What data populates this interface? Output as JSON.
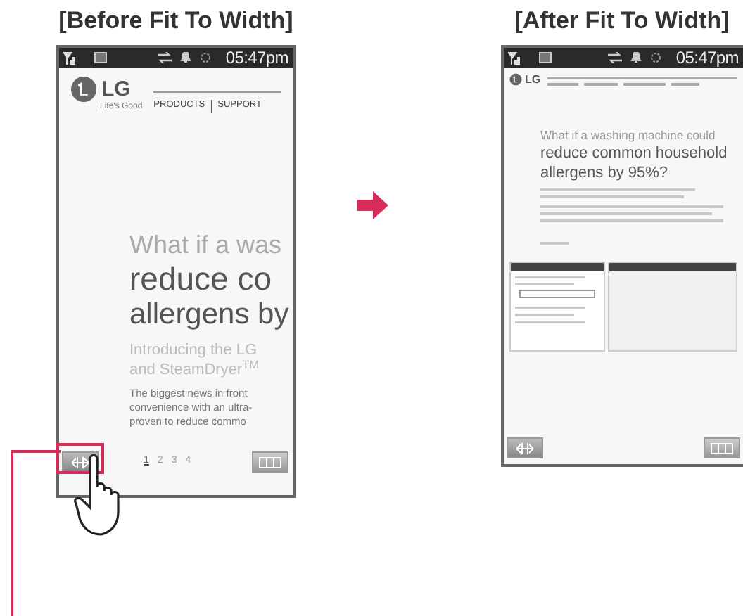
{
  "panels": [
    {
      "kind": "before",
      "caption": "[Before Fit To Width]",
      "status_bar": {
        "time": "05:47pm"
      },
      "logo": {
        "brand": "LG",
        "tagline": "Life's Good"
      },
      "nav": [
        "PRODUCTS",
        "SUPPORT"
      ],
      "headline": [
        "What if a was",
        "reduce co",
        "allergens by"
      ],
      "intro": [
        "Introducing the LG",
        "and SteamDryer$^{TM}$"
      ],
      "body": [
        "The biggest news in front",
        "convenience with an ultra-",
        "proven to reduce commo"
      ],
      "pager": [
        {
          "label": "1",
          "selected": true
        },
        {
          "label": "2",
          "selected": false
        },
        {
          "label": "3",
          "selected": false
        },
        {
          "label": "4",
          "selected": false
        }
      ]
    },
    {
      "kind": "after",
      "caption": "[After Fit To Width]",
      "status_bar": {
        "time": "05:47pm"
      },
      "logo": {
        "brand": "LG"
      },
      "headline": [
        "What if a washing machine could",
        "reduce common household",
        "allergens by 95%?"
      ]
    }
  ]
}
